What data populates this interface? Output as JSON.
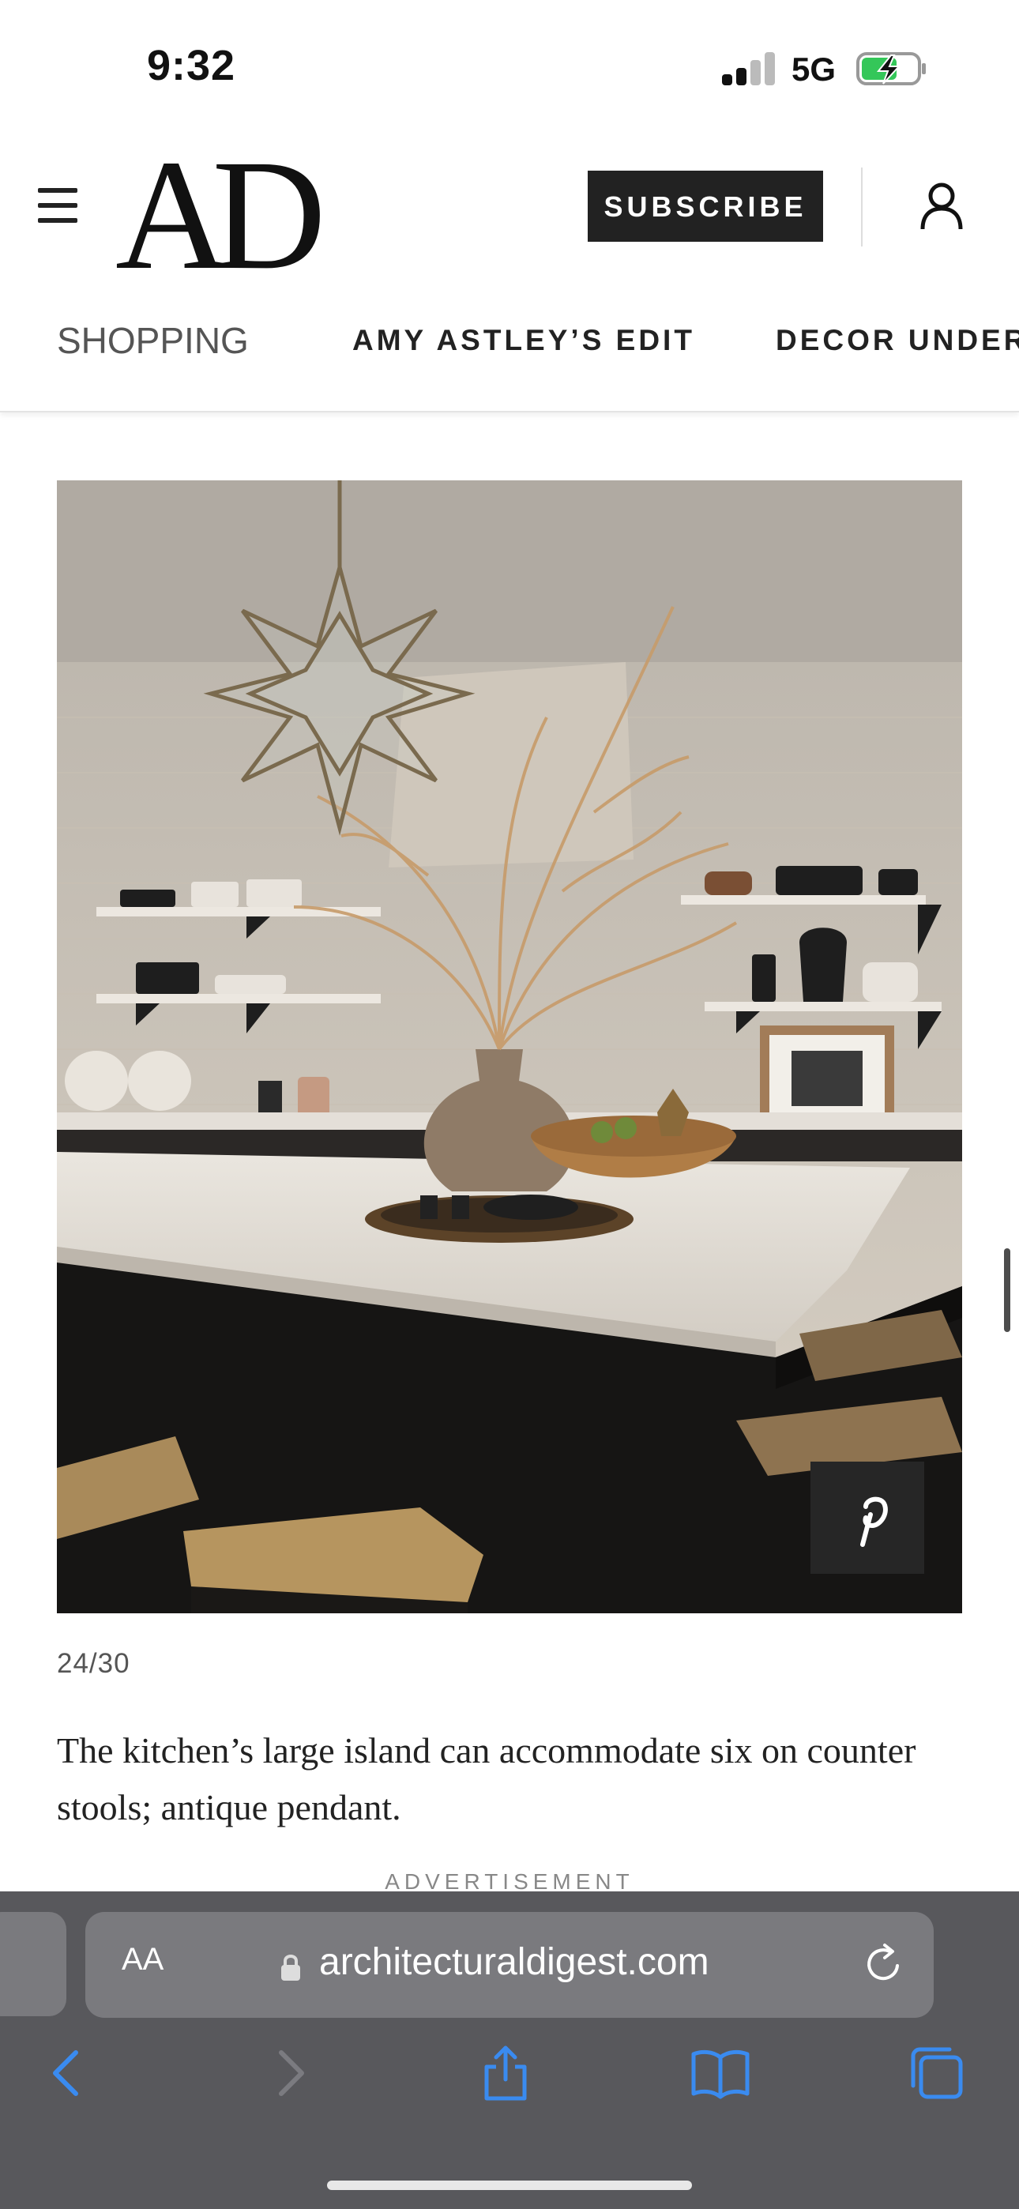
{
  "status_bar": {
    "time": "9:32",
    "network": "5G"
  },
  "header": {
    "logo": "AD",
    "subscribe_label": "SUBSCRIBE"
  },
  "nav": {
    "items": [
      "SHOPPING",
      "AMY ASTLEY’S EDIT",
      "DECOR UNDER"
    ]
  },
  "gallery": {
    "counter": "24/30",
    "caption": "The kitchen’s large island can accommodate six on counter stools; antique pendant.",
    "advertisement_label": "ADVERTISEMENT"
  },
  "browser": {
    "text_size_label": "AA",
    "url": "architecturaldigest.com"
  },
  "colors": {
    "subscribe_bg": "#222222",
    "safari_bar": "#58585c",
    "link_blue": "#3a8bf0"
  },
  "icons": [
    "menu-icon",
    "account-icon",
    "pinterest-icon",
    "lock-icon",
    "reload-icon",
    "back-icon",
    "forward-icon",
    "share-icon",
    "bookmarks-icon",
    "tabs-icon"
  ]
}
